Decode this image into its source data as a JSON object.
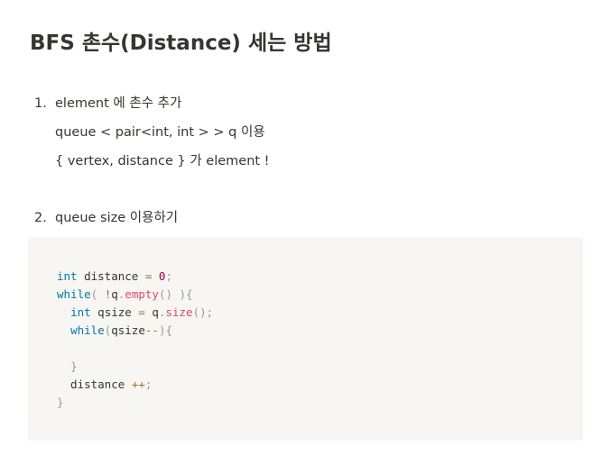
{
  "title": "BFS 촌수(Distance) 세는 방법",
  "list": [
    {
      "number": "1.",
      "lines": [
        "element 에 촌수 추가",
        "queue < pair<int, int > > q 이용",
        "{ vertex, distance }  가 element !"
      ]
    },
    {
      "number": "2.",
      "lines": [
        "queue size 이용하기"
      ]
    }
  ],
  "code": {
    "language": "cpp",
    "lines": [
      [
        {
          "t": "int",
          "c": "kw"
        },
        {
          "t": " distance "
        },
        {
          "t": "=",
          "c": "op"
        },
        {
          "t": " "
        },
        {
          "t": "0",
          "c": "num"
        },
        {
          "t": ";",
          "c": "punc"
        }
      ],
      [
        {
          "t": "while",
          "c": "kw"
        },
        {
          "t": "(",
          "c": "punc"
        },
        {
          "t": " "
        },
        {
          "t": "!",
          "c": "op"
        },
        {
          "t": "q"
        },
        {
          "t": ".",
          "c": "punc"
        },
        {
          "t": "empty",
          "c": "fn"
        },
        {
          "t": "()",
          "c": "punc"
        },
        {
          "t": " "
        },
        {
          "t": "){",
          "c": "punc"
        }
      ],
      [
        {
          "t": "  "
        },
        {
          "t": "int",
          "c": "kw"
        },
        {
          "t": " qsize "
        },
        {
          "t": "=",
          "c": "op"
        },
        {
          "t": " q"
        },
        {
          "t": ".",
          "c": "punc"
        },
        {
          "t": "size",
          "c": "fn"
        },
        {
          "t": "();",
          "c": "punc"
        }
      ],
      [
        {
          "t": "  "
        },
        {
          "t": "while",
          "c": "kw"
        },
        {
          "t": "(",
          "c": "punc"
        },
        {
          "t": "qsize"
        },
        {
          "t": "--",
          "c": "op"
        },
        {
          "t": "){",
          "c": "punc"
        }
      ],
      [],
      [
        {
          "t": "  "
        },
        {
          "t": "}",
          "c": "punc"
        }
      ],
      [
        {
          "t": "  distance "
        },
        {
          "t": "++",
          "c": "op"
        },
        {
          "t": ";",
          "c": "punc"
        }
      ],
      [
        {
          "t": "}",
          "c": "punc"
        }
      ]
    ]
  }
}
